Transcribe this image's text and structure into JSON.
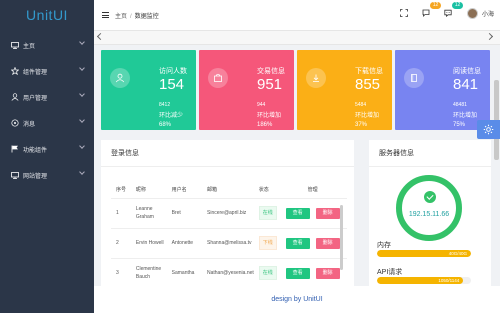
{
  "app": {
    "logo": "UnitUI"
  },
  "sidebar": {
    "items": [
      {
        "label": "主页",
        "icon": "monitor-icon"
      },
      {
        "label": "组件管理",
        "icon": "star-icon"
      },
      {
        "label": "用户管理",
        "icon": "user-icon"
      },
      {
        "label": "消息",
        "icon": "bell-icon"
      },
      {
        "label": "功能组件",
        "icon": "flag-icon"
      },
      {
        "label": "网站管理",
        "icon": "monitor-icon"
      }
    ]
  },
  "header": {
    "breadcrumb": [
      "主页",
      "数据监控"
    ],
    "notifications": {
      "comments_badge": "12",
      "messages_badge": "12"
    },
    "user": {
      "name": "小海"
    }
  },
  "colors": {
    "card_green": "#20c997",
    "card_red": "#f5577a",
    "card_orange": "#fbaf16",
    "card_purple": "#7884f1",
    "badge_orange": "#f5a623",
    "badge_teal": "#1bc0a3"
  },
  "stats": [
    {
      "title": "访问人数",
      "value": "154",
      "small": "8412",
      "trend_label": "环比减少",
      "trend_value": "68%",
      "icon": "user-icon"
    },
    {
      "title": "交易信息",
      "value": "951",
      "small": "944",
      "trend_label": "环比增加",
      "trend_value": "186%",
      "icon": "bag-icon"
    },
    {
      "title": "下载信息",
      "value": "855",
      "small": "5484",
      "trend_label": "环比增加",
      "trend_value": "37%",
      "icon": "download-icon"
    },
    {
      "title": "阅读信息",
      "value": "841",
      "small": "48481",
      "trend_label": "环比增加",
      "trend_value": "75%",
      "icon": "book-icon"
    }
  ],
  "login_panel": {
    "title": "登录信息",
    "columns": [
      "序号",
      "昵称",
      "用户名",
      "邮箱",
      "状态",
      "管理"
    ],
    "rows": [
      {
        "index": "1",
        "nickname": "Leanne Graham",
        "username": "Bret",
        "email": "Sincere@april.biz",
        "status": "在线",
        "online": true
      },
      {
        "index": "2",
        "nickname": "Ervin Howell",
        "username": "Antonette",
        "email": "Shanna@melissa.tv",
        "status": "下线",
        "online": false
      },
      {
        "index": "3",
        "nickname": "Clementine Bauch",
        "username": "Samantha",
        "email": "Nathan@yesenia.net",
        "status": "在线",
        "online": true
      }
    ],
    "view_label": "查看",
    "delete_label": "删除"
  },
  "server_panel": {
    "title": "服务器信息",
    "ip": "192.15.11.66",
    "memory": {
      "label": "内存",
      "text": "40G/40G",
      "fraction": 1.0
    },
    "api": {
      "label": "API请求",
      "text": "1050/1144",
      "fraction": 0.918
    }
  },
  "footer": {
    "text": "design by UnitUI"
  }
}
